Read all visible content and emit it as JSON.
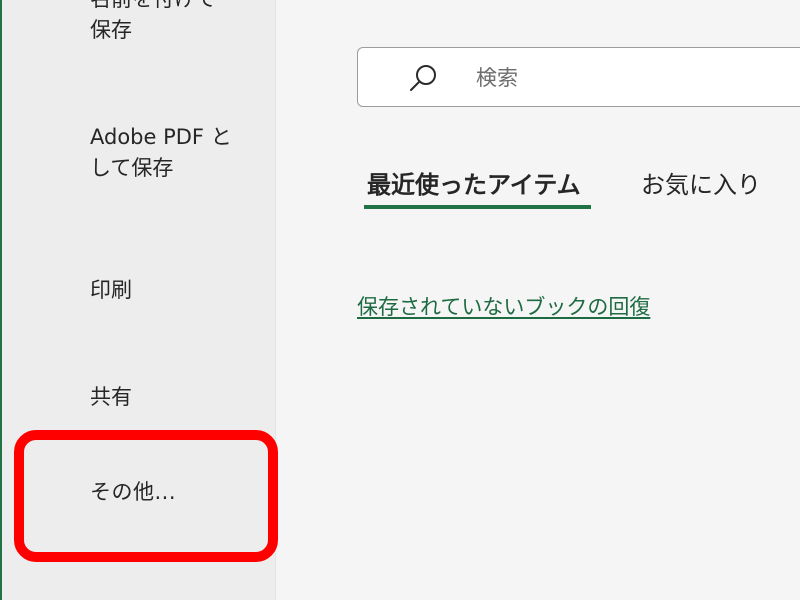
{
  "sidebar": {
    "save_as_name": [
      "名前を付けて",
      "保存"
    ],
    "adobe_pdf": [
      "Adobe PDF と",
      "して保存"
    ],
    "print": "印刷",
    "share": "共有",
    "more": "その他..."
  },
  "search": {
    "icon": "search-icon",
    "placeholder": "検索"
  },
  "tabs": [
    {
      "label": "最近使ったアイテム",
      "selected": true
    },
    {
      "label": "お気に入り",
      "selected": false
    }
  ],
  "recover_link": "保存されていないブックの回復",
  "colors": {
    "accent": "#217346",
    "highlight": "#ff0000",
    "link": "#1e6b43"
  }
}
